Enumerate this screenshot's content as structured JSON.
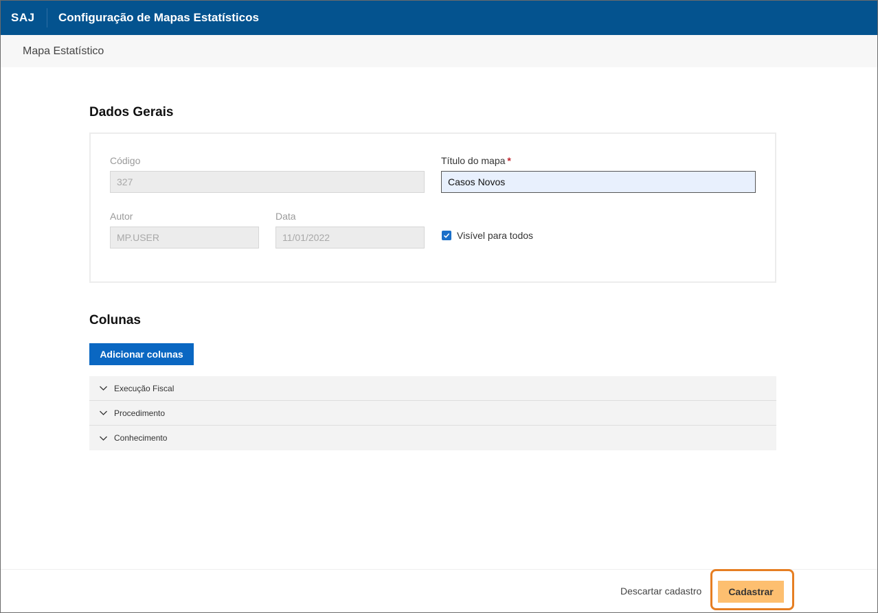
{
  "header": {
    "brand": "SAJ",
    "title": "Configuração de Mapas Estatísticos"
  },
  "breadcrumb": {
    "label": "Mapa Estatístico"
  },
  "general": {
    "title": "Dados Gerais",
    "codigo": {
      "label": "Código",
      "value": "327"
    },
    "titulo": {
      "label": "Título do mapa",
      "required_mark": "*",
      "value": "Casos Novos"
    },
    "autor": {
      "label": "Autor",
      "value": "MP.USER"
    },
    "data": {
      "label": "Data",
      "value": "11/01/2022"
    },
    "visivel": {
      "label": "Visível para todos",
      "checked": true
    }
  },
  "columns": {
    "title": "Colunas",
    "add_label": "Adicionar colunas",
    "items": [
      {
        "label": "Execução Fiscal"
      },
      {
        "label": "Procedimento"
      },
      {
        "label": "Conhecimento"
      }
    ]
  },
  "footer": {
    "discard_label": "Descartar cadastro",
    "submit_label": "Cadastrar"
  },
  "colors": {
    "header_bg": "#04538f",
    "primary_button": "#0a67c2",
    "submit_button": "#fdbf70",
    "highlight": "#e67e22",
    "checkbox": "#1a6fc9"
  },
  "icons": {
    "accordion": "chevron-down-icon",
    "checkbox": "check-icon"
  }
}
